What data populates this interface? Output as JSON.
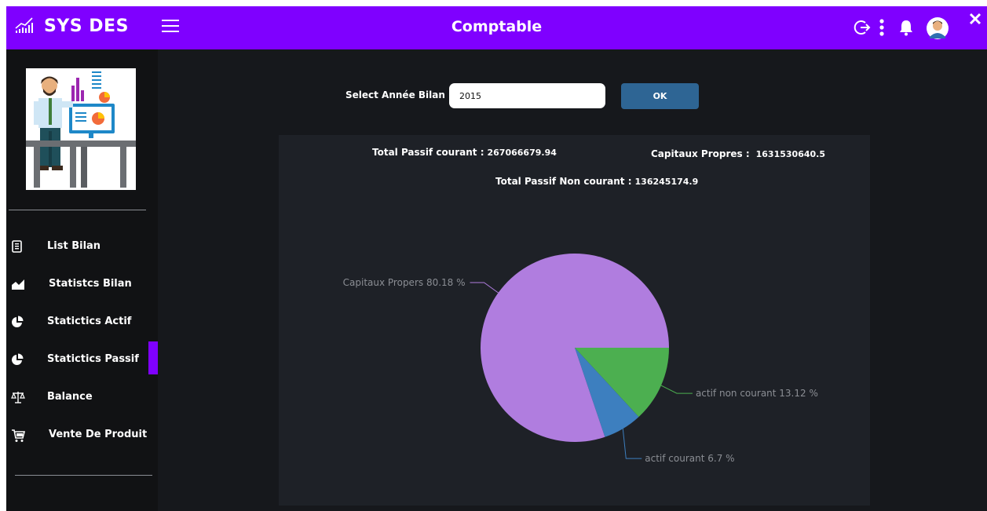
{
  "app": {
    "brand": "SYS DES",
    "page_title": "Comptable"
  },
  "colors": {
    "topbar": "#7f00ff",
    "button": "#2e6594"
  },
  "icons": [
    "chart-icon",
    "menu-icon",
    "logout-icon",
    "more-vertical-icon",
    "bell-icon",
    "avatar-icon",
    "close-icon"
  ],
  "sidebar": {
    "items": [
      {
        "label": "List Bilan",
        "icon": "list-icon"
      },
      {
        "label": "Statistcs Bilan",
        "icon": "area-chart-icon"
      },
      {
        "label": "Statictics Actif",
        "icon": "pie-chart-icon"
      },
      {
        "label": "Statictics Passif",
        "icon": "pie-chart-icon",
        "active": true
      },
      {
        "label": "Balance",
        "icon": "scale-icon"
      },
      {
        "label": "Vente De Produit",
        "icon": "cart-icon"
      }
    ]
  },
  "filter": {
    "label": "Select Année Bilan",
    "year_value": "2015",
    "ok_label": "OK"
  },
  "stats": {
    "passif_courant_label": "Total Passif courant :",
    "passif_courant_value": "267066679.94",
    "capitaux_label": "Capitaux Propres :",
    "capitaux_value": "1631530640.5",
    "passif_non_courant_label": "Total Passif Non courant :",
    "passif_non_courant_value": "136245174.9"
  },
  "chart_data": {
    "type": "pie",
    "slices": [
      {
        "name": "Capitaux Propers",
        "value": 80.18,
        "label": "Capitaux Propers 80.18 %",
        "color": "#b07ddf"
      },
      {
        "name": "actif courant",
        "value": 6.7,
        "label": "actif courant 6.7 %",
        "color": "#3d7fbf"
      },
      {
        "name": "actif non courant",
        "value": 13.12,
        "label": "actif non courant 13.12  %",
        "color": "#4caf50"
      }
    ]
  }
}
